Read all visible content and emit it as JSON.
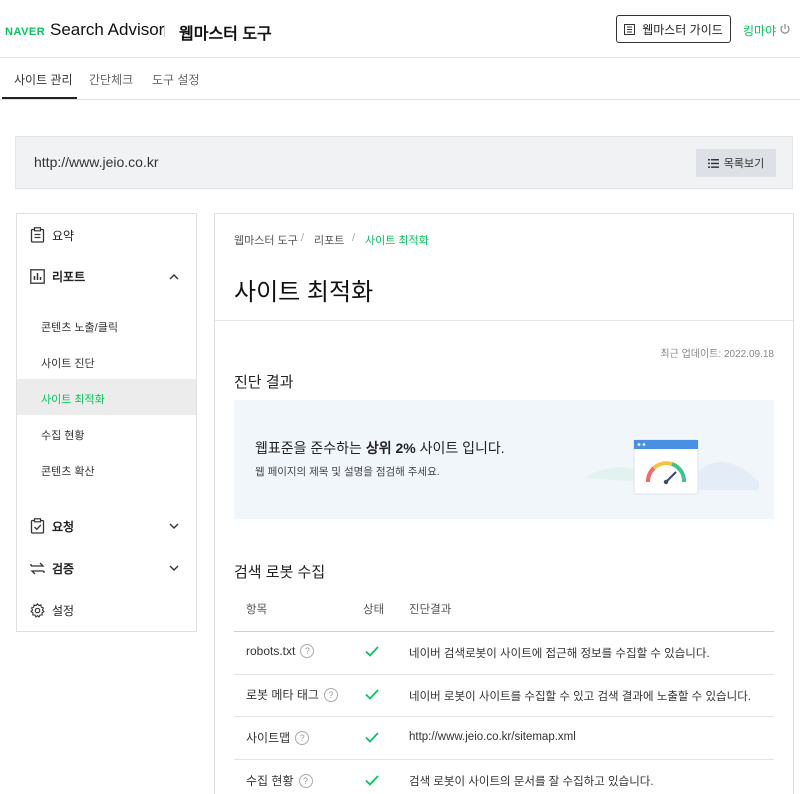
{
  "header": {
    "naver_logo": "NAVER",
    "app_name": "Search Advisor",
    "tool_name": "웹마스터 도구",
    "guide_button": "웹마스터 가이드",
    "user_name": "킹마야",
    "accent_color": "#03c75a"
  },
  "nav": {
    "tabs": [
      {
        "label": "사이트 관리",
        "active": true
      },
      {
        "label": "간단체크",
        "active": false
      },
      {
        "label": "도구 설정",
        "active": false
      }
    ]
  },
  "site": {
    "url": "http://www.jeio.co.kr",
    "list_button": "목록보기"
  },
  "sidebar": {
    "items": [
      {
        "label": "요약",
        "icon": "clipboard-icon"
      },
      {
        "label": "리포트",
        "icon": "chart-icon",
        "expanded": true
      },
      {
        "label": "요청",
        "icon": "check-doc-icon"
      },
      {
        "label": "검증",
        "icon": "swap-icon"
      },
      {
        "label": "설정",
        "icon": "gear-icon"
      }
    ],
    "report_sub": [
      {
        "label": "콘텐츠 노출/클릭"
      },
      {
        "label": "사이트 진단"
      },
      {
        "label": "사이트 최적화",
        "active": true
      },
      {
        "label": "수집 현황"
      },
      {
        "label": "콘텐츠 확산"
      }
    ]
  },
  "breadcrumb": [
    "웹마스터 도구",
    "리포트",
    "사이트 최적화"
  ],
  "page_title": "사이트 최적화",
  "updated": "최근 업데이트: 2022.09.18",
  "diagnosis": {
    "title": "진단 결과",
    "message_pre": "웹표준을 준수하는 ",
    "message_bold": "상위 2%",
    "message_post": " 사이트 입니다.",
    "sub": "웹 페이지의 제목 및 설명을 점검해 주세요."
  },
  "robot": {
    "title": "검색 로봇 수집",
    "columns": [
      "항목",
      "상태",
      "진단결과"
    ],
    "rows": [
      {
        "item": "robots.txt",
        "status": "ok",
        "result": "네이버 검색로봇이 사이트에 접근해 정보를 수집할 수 있습니다."
      },
      {
        "item": "로봇 메타 태그",
        "status": "ok",
        "result": "네이버 로봇이 사이트를 수집할 수 있고 검색 결과에 노출할 수 있습니다."
      },
      {
        "item": "사이트맵",
        "status": "ok",
        "result": "http://www.jeio.co.kr/sitemap.xml"
      },
      {
        "item": "수집 현황",
        "status": "ok",
        "result": "검색 로봇이 사이트의 문서를 잘 수집하고 있습니다."
      }
    ]
  }
}
